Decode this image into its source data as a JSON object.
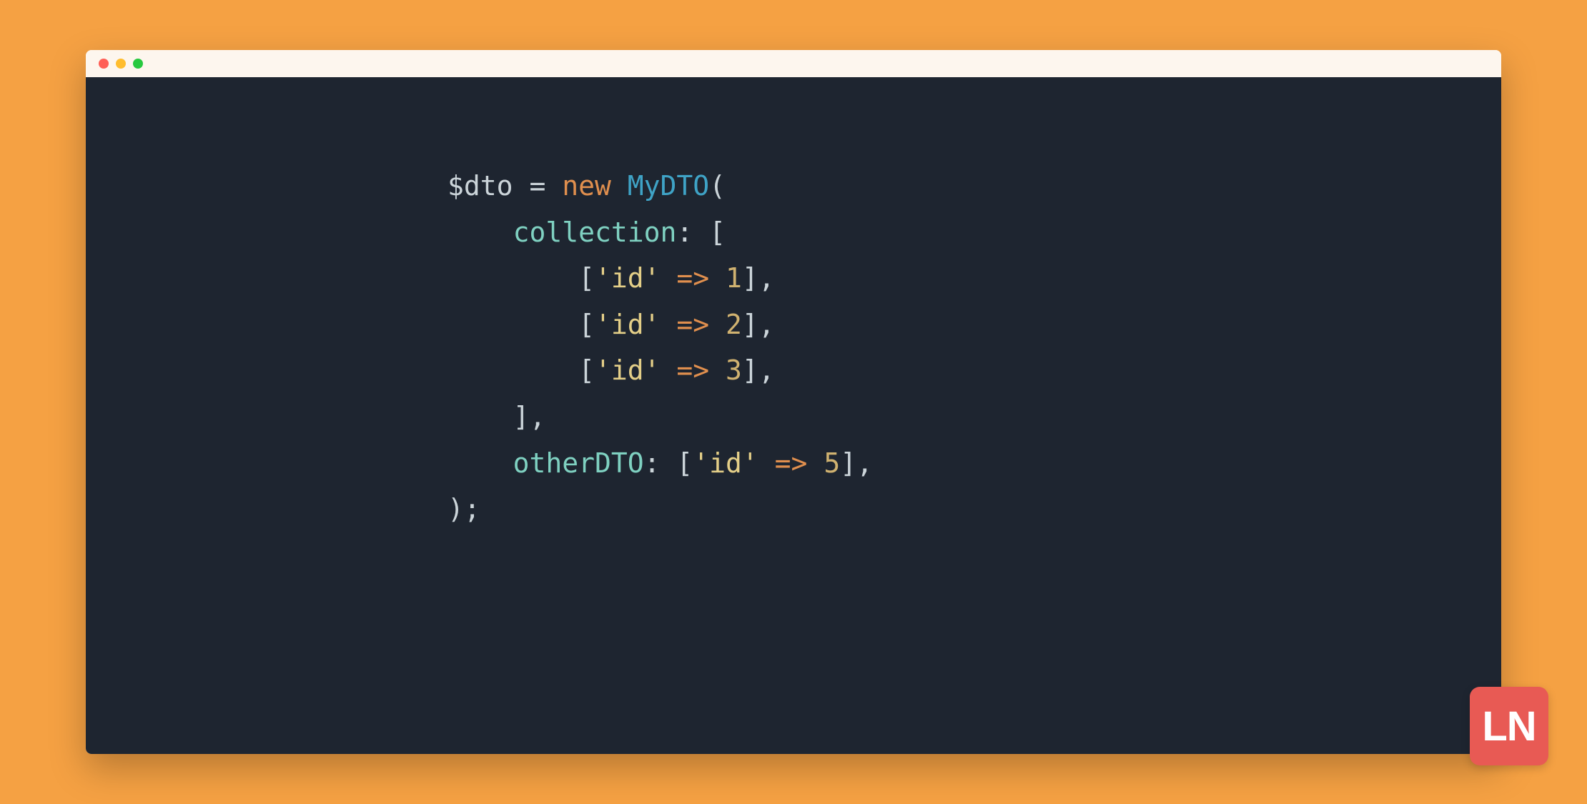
{
  "code": {
    "var": "$dto",
    "assign": "=",
    "keyword_new": "new",
    "class_name": "MyDTO",
    "open_paren": "(",
    "close_paren": ")",
    "semicolon": ";",
    "param_collection": "collection",
    "colon": ":",
    "open_bracket": "[",
    "close_bracket": "]",
    "comma": ",",
    "entries": [
      {
        "key": "'id'",
        "arrow": "=>",
        "value": "1"
      },
      {
        "key": "'id'",
        "arrow": "=>",
        "value": "2"
      },
      {
        "key": "'id'",
        "arrow": "=>",
        "value": "3"
      }
    ],
    "param_other": "otherDTO",
    "other_entry": {
      "key": "'id'",
      "arrow": "=>",
      "value": "5"
    }
  },
  "logo": "LN",
  "colors": {
    "background": "#f5a143",
    "editor_bg": "#1e2530",
    "titlebar_bg": "#fdf6ee",
    "logo_bg": "#e85a54"
  }
}
